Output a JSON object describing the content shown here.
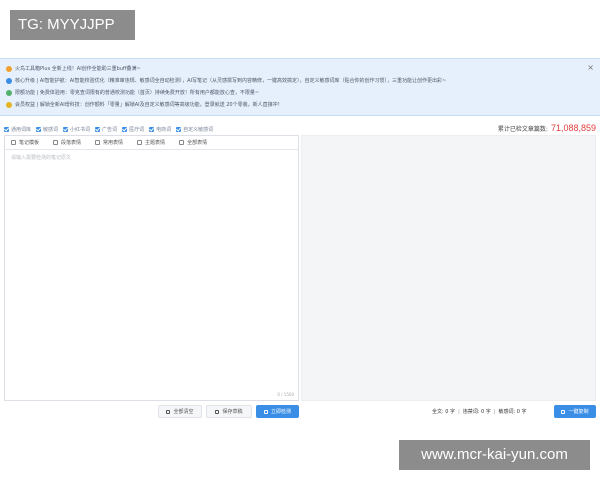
{
  "watermark_top": "TG: MYYJJPP",
  "watermark_bottom": "www.mcr-kai-yun.com",
  "notice": {
    "line1": "火鸟工具箱Plus 全新上线！AI创作全能助三重buff叠满~",
    "line2": "核心升级 | AI智能护航：AI智能校验优化（精准审违规、敏感词全自动检测），AI写笔记（从灵感撰写到内容精修，一键高效搞定），自定义敏感词库（贴合你的创作习惯），三重功能让创作更出彩~",
    "line3": "限额功能 | 免费体验用：零克查词限有的普通校测功能（首页）持续免费开放！所有用户都能放心查，不限量~",
    "line4": "会员权益 | 解锁全新AI增科技：创作额料「零量」解锁AI及自定义敏感词等高级功能，登录就送 20个零装，新人直接冲！",
    "close_glyph": "×"
  },
  "filters": [
    {
      "label": "通用词库"
    },
    {
      "label": "敏感词"
    },
    {
      "label": "小红书词"
    },
    {
      "label": "广告词"
    },
    {
      "label": "医疗词"
    },
    {
      "label": "电商词"
    },
    {
      "label": "自定义敏感词"
    }
  ],
  "counter": {
    "label": "累计已检文章篇数:",
    "value": "71,088,859"
  },
  "tabs": [
    {
      "label": "笔记模板"
    },
    {
      "label": "段落表情"
    },
    {
      "label": "常用表情"
    },
    {
      "label": "主题表情"
    },
    {
      "label": "全部表情"
    }
  ],
  "editor": {
    "placeholder": "请输入需要检测的笔记原文",
    "char_count": "0 / 1500"
  },
  "buttons": {
    "clear": "全部清空",
    "draft": "保存草稿",
    "check": "立即检测",
    "copy": "一键复制"
  },
  "stats": {
    "full_label": "全文:",
    "full_value": "0 字",
    "banned_label": "违禁词:",
    "banned_value": "0 字",
    "sensitive_label": "敏感词:",
    "sensitive_value": "0 字"
  },
  "colors": {
    "accent": "#3a8ee6",
    "counter": "#e03c3c",
    "notice_bg": "#e6f0fd"
  }
}
